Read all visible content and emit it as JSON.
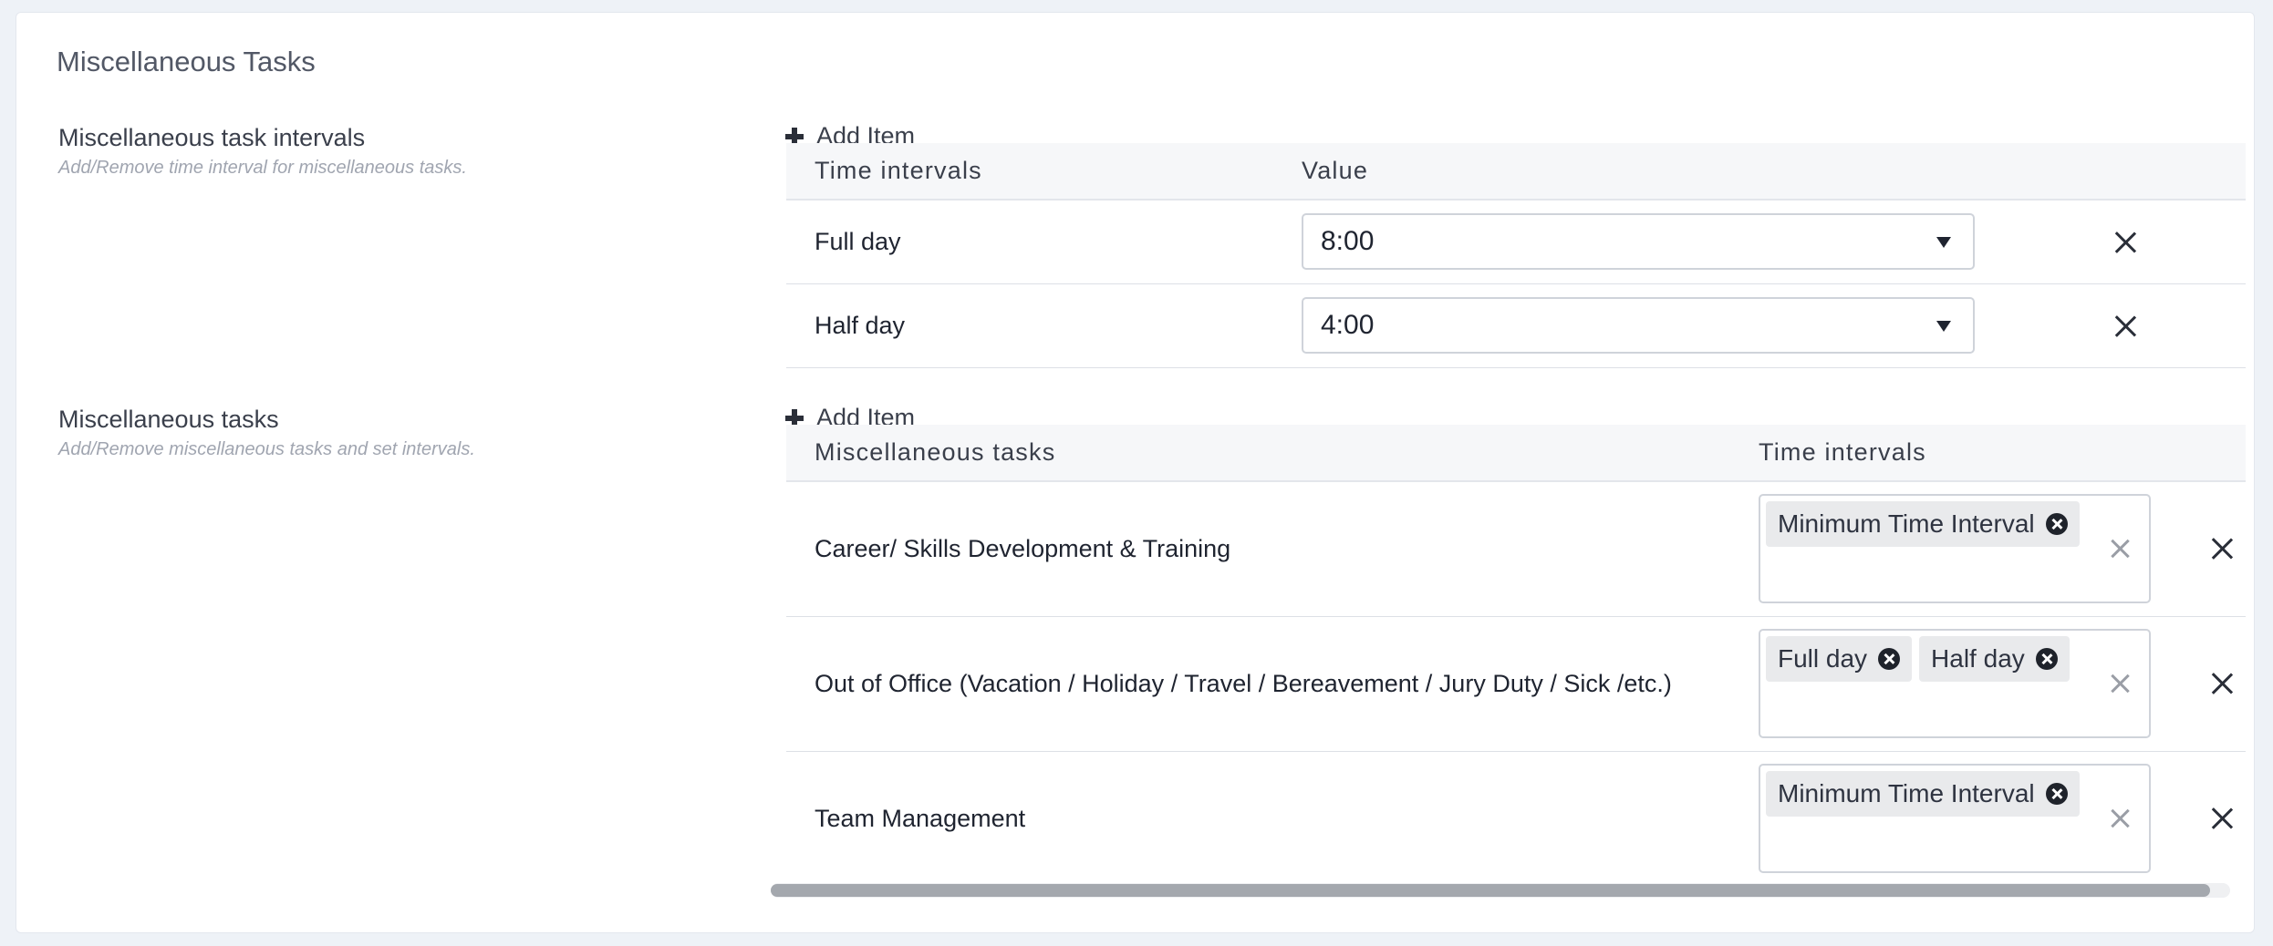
{
  "page": {
    "title": "Miscellaneous Tasks"
  },
  "intervals_section": {
    "title": "Miscellaneous task intervals",
    "description": "Add/Remove time interval for miscellaneous tasks.",
    "add_label": "Add Item",
    "columns": [
      "Time intervals",
      "Value"
    ],
    "rows": [
      {
        "name": "Full day",
        "value": "8:00"
      },
      {
        "name": "Half day",
        "value": "4:00"
      }
    ]
  },
  "tasks_section": {
    "title": "Miscellaneous tasks",
    "description": "Add/Remove miscellaneous tasks and set intervals.",
    "add_label": "Add Item",
    "columns": [
      "Miscellaneous tasks",
      "Time intervals"
    ],
    "rows": [
      {
        "name": "Career/ Skills Development & Training",
        "intervals": [
          "Minimum Time Interval"
        ]
      },
      {
        "name": "Out of Office (Vacation / Holiday / Travel / Bereavement / Jury Duty / Sick /etc.)",
        "intervals": [
          "Full day",
          "Half day"
        ]
      },
      {
        "name": "Team Management",
        "intervals": [
          "Minimum Time Interval"
        ]
      }
    ]
  },
  "scrollbar": {
    "position_fraction": 0.0,
    "visible_fraction": 0.986
  },
  "colors": {
    "background": "#eef2f7",
    "card": "#ffffff",
    "header_row": "#f6f7f9",
    "chip": "#e9eaec"
  }
}
